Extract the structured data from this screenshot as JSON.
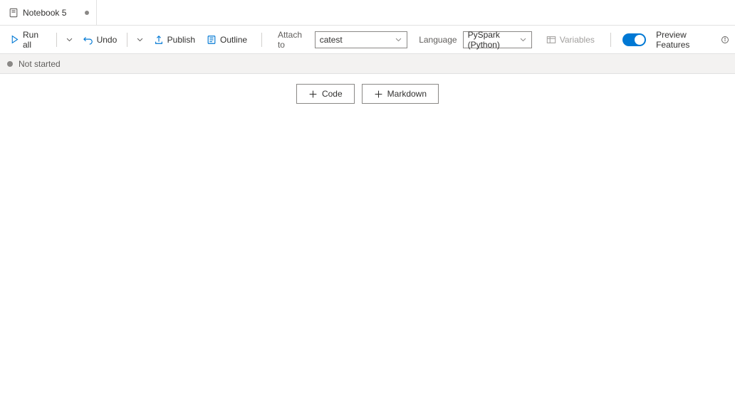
{
  "tab": {
    "title": "Notebook 5"
  },
  "toolbar": {
    "run_all_label": "Run all",
    "undo_label": "Undo",
    "publish_label": "Publish",
    "outline_label": "Outline",
    "attach_to_label": "Attach to",
    "attach_to_value": "catest",
    "language_label": "Language",
    "language_value": "PySpark (Python)",
    "variables_label": "Variables",
    "preview_features_label": "Preview Features"
  },
  "status": {
    "text": "Not started"
  },
  "add_cell": {
    "code_label": "Code",
    "markdown_label": "Markdown"
  }
}
